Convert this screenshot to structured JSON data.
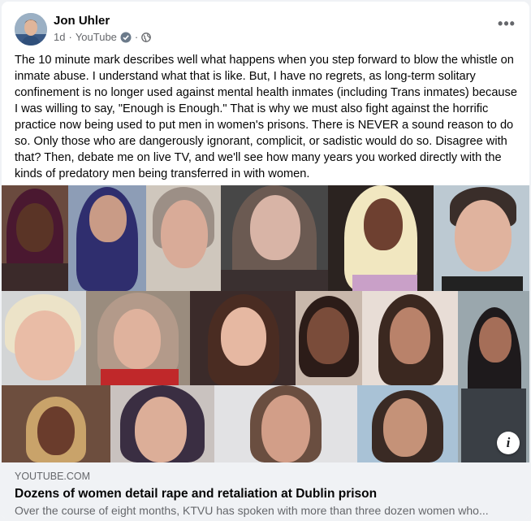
{
  "post": {
    "author": "Jon Uhler",
    "time": "1d",
    "separator": "·",
    "source": "YouTube",
    "icons": {
      "verified": "verified-badge-icon",
      "audience": "globe-icon",
      "menu": "more-options-icon"
    },
    "more_label": "•••",
    "text": "The 10 minute mark describes well what happens when you step forward to blow the whistle on inmate abuse. I understand what that is like. But, I have no regrets, as long-term solitary confinement is no longer used against mental health inmates (including Trans inmates) because I was willing to say, \"Enough is Enough.\" That is why we must also fight against the horrific practice now being used to put men in women's prisons. There is NEVER a sound reason to do so. Only those who are dangerously ignorant, complicit, or sadistic would do so. Disagree with that? Then, debate me on live TV, and we'll see how many years you worked directly with the kinds of predatory men being transferred in with women."
  },
  "link_preview": {
    "domain": "YOUTUBE.COM",
    "title": "Dozens of women detail rape and retaliation at Dublin prison",
    "description": "Over the course of eight months, KTVU has spoken with more than three dozen women who...",
    "info_label": "i"
  },
  "colors": {
    "accent_blue": "#1877f2",
    "text_primary": "#050505",
    "text_secondary": "#65676b",
    "preview_bg": "#f0f2f5"
  }
}
